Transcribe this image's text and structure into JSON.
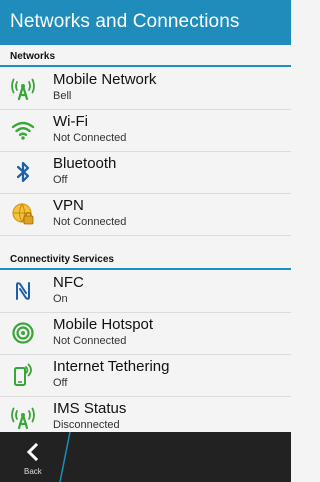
{
  "titlebar": {
    "title": "Networks and Connections"
  },
  "sections": {
    "networks": {
      "label": "Networks",
      "items": [
        {
          "label": "Mobile Network",
          "status": "Bell",
          "icon": "mobile-network-icon"
        },
        {
          "label": "Wi-Fi",
          "status": "Not Connected",
          "icon": "wifi-icon"
        },
        {
          "label": "Bluetooth",
          "status": "Off",
          "icon": "bluetooth-icon"
        },
        {
          "label": "VPN",
          "status": "Not Connected",
          "icon": "vpn-icon"
        }
      ]
    },
    "services": {
      "label": "Connectivity Services",
      "items": [
        {
          "label": "NFC",
          "status": "On",
          "icon": "nfc-icon"
        },
        {
          "label": "Mobile Hotspot",
          "status": "Not Connected",
          "icon": "hotspot-icon"
        },
        {
          "label": "Internet Tethering",
          "status": "Off",
          "icon": "tethering-icon"
        },
        {
          "label": "IMS Status",
          "status": "Disconnected",
          "icon": "ims-icon"
        }
      ]
    }
  },
  "bottombar": {
    "back_label": "Back"
  },
  "colors": {
    "accent": "#1f8cbc",
    "icon_green": "#3aa63a",
    "icon_blue": "#1a5fa8",
    "icon_gold": "#e8a820"
  }
}
